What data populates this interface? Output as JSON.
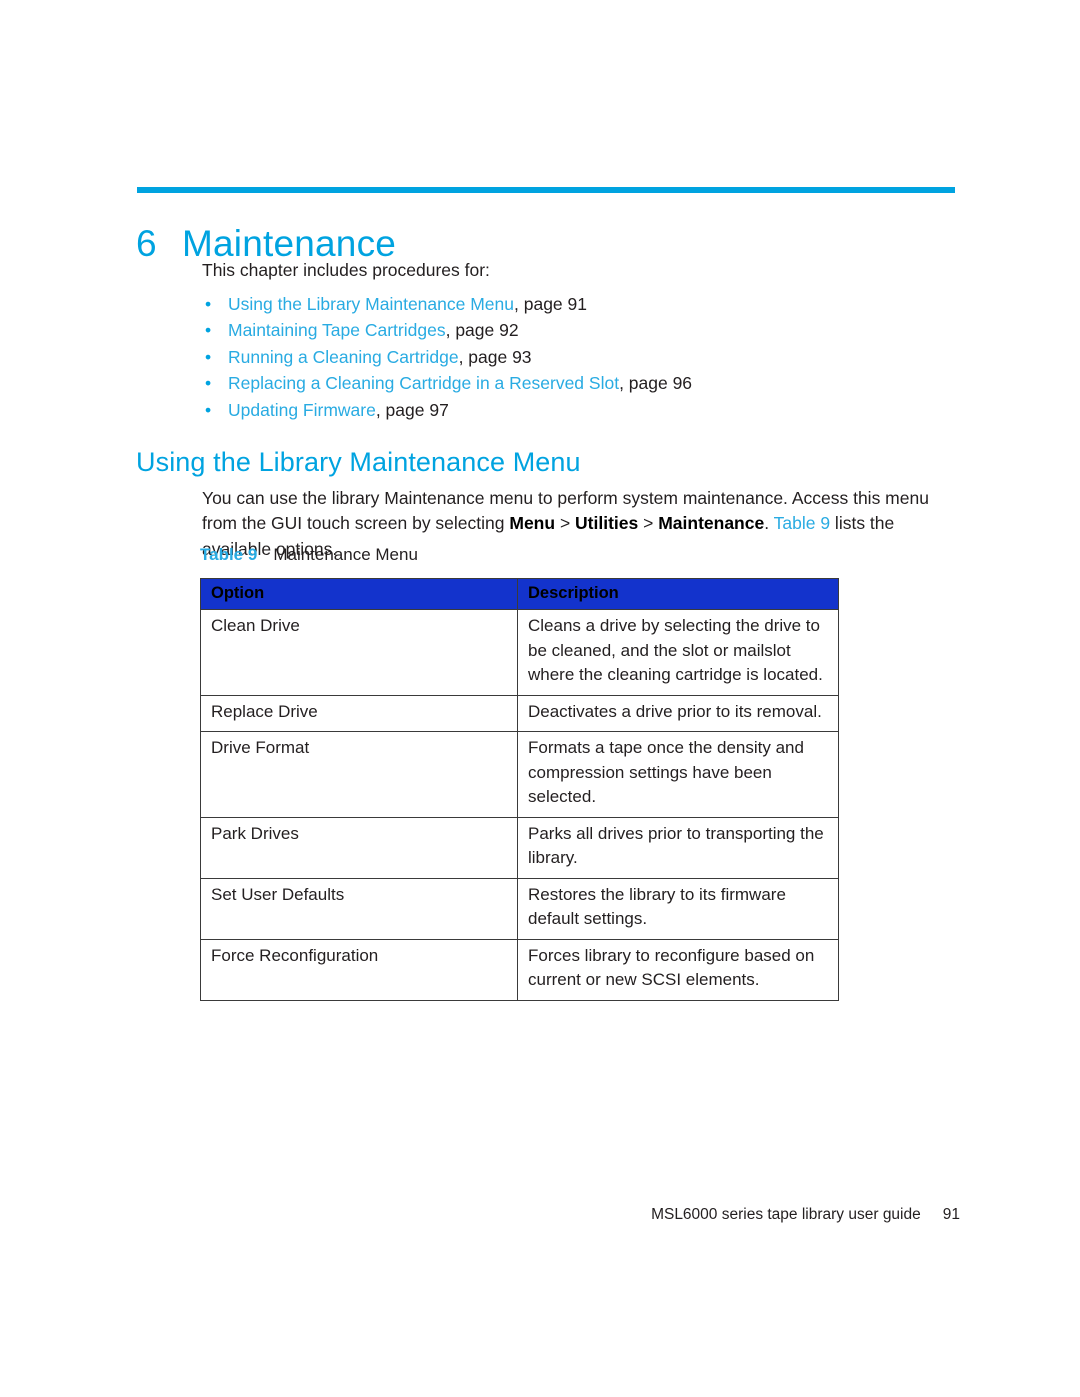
{
  "chapter": {
    "number": "6",
    "title": "Maintenance",
    "rule_color": "#00a3e0",
    "title_color": "#00a3e0"
  },
  "intro": {
    "lead_in": "This chapter includes procedures for:",
    "bullets": [
      {
        "bullet": "•",
        "link": "Using the Library Maintenance Menu",
        "tail": ", page 91"
      },
      {
        "bullet": "•",
        "link": "Maintaining Tape Cartridges",
        "tail": ", page 92"
      },
      {
        "bullet": "•",
        "link": "Running a Cleaning Cartridge",
        "tail": ", page 93"
      },
      {
        "bullet": "•",
        "link": "Replacing a Cleaning Cartridge in a Reserved Slot",
        "tail": ", page 96"
      },
      {
        "bullet": "•",
        "link": "Updating Firmware",
        "tail": ", page 97"
      }
    ]
  },
  "section": {
    "heading": "Using the Library Maintenance Menu",
    "paragraph": {
      "part1": "You can use the library Maintenance menu to perform system maintenance. Access this menu from the GUI touch screen by selecting ",
      "bold1": "Menu",
      "sep1": " > ",
      "bold2": "Utilities",
      "sep2": " > ",
      "bold3": "Maintenance",
      "part2": ". ",
      "xref": "Table 9",
      "part3": " lists the available options."
    }
  },
  "table": {
    "caption_label": "Table 9",
    "caption_text": "Maintenance Menu",
    "header_bg": "#1333cc",
    "headers": [
      "Option",
      "Description"
    ],
    "rows": [
      {
        "option": "Clean Drive",
        "description": "Cleans a drive by selecting the drive to be cleaned, and the slot or mailslot where the cleaning cartridge is located."
      },
      {
        "option": "Replace Drive",
        "description": "Deactivates a drive prior to its removal."
      },
      {
        "option": "Drive Format",
        "description": "Formats a tape once the density and compression settings have been selected."
      },
      {
        "option": "Park Drives",
        "description": "Parks all drives prior to transporting the library."
      },
      {
        "option": "Set User Defaults",
        "description": "Restores the library to its firmware default settings."
      },
      {
        "option": "Force Reconfiguration",
        "description": "Forces library to reconfigure based on current or new SCSI elements."
      }
    ]
  },
  "footer": {
    "guide_title": "MSL6000 series tape library user guide",
    "page_number": "91"
  }
}
